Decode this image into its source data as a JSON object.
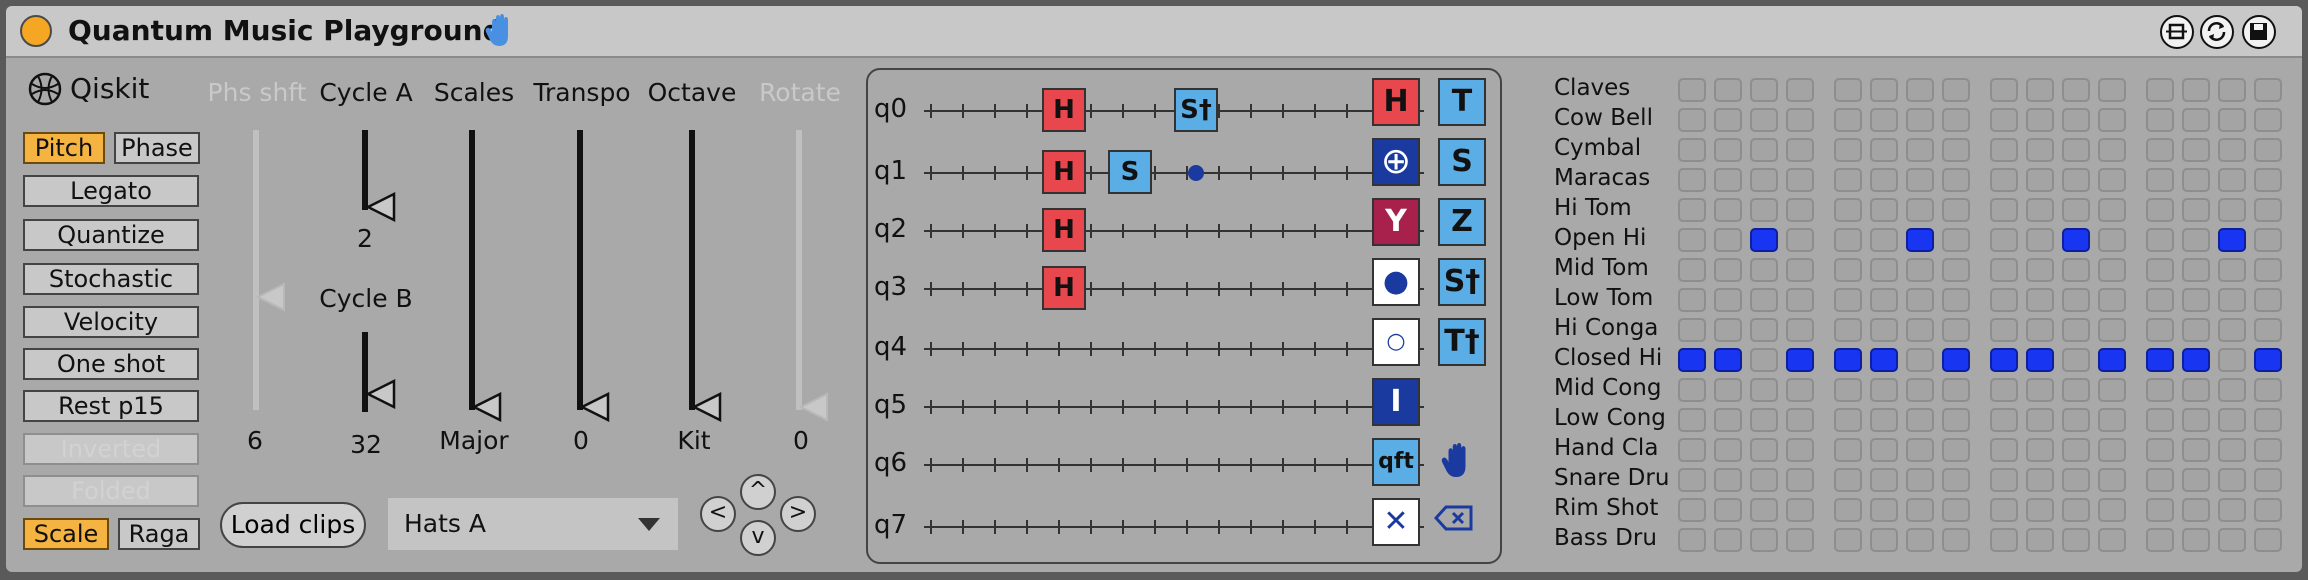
{
  "window": {
    "title": "Quantum Music Playground"
  },
  "colors": {
    "accent_orange": "#f5b342",
    "gate_red": "#e8474e",
    "gate_blue": "#5aaee5",
    "navy": "#1a3aa0",
    "step_on": "#1836f2"
  },
  "left_panel": {
    "logo_text": "Qiskit",
    "buttons": {
      "pitch": "Pitch",
      "phase": "Phase",
      "legato": "Legato",
      "quantize": "Quantize",
      "stochastic": "Stochastic",
      "velocity": "Velocity",
      "one_shot": "One shot",
      "rest": "Rest p15",
      "inverted": "Inverted",
      "folded": "Folded",
      "scale": "Scale",
      "raga": "Raga"
    },
    "toggles": {
      "pitch": true,
      "phase": false,
      "scale": true,
      "raga": false,
      "inverted": false,
      "folded": false
    }
  },
  "controls": {
    "phs_shft": {
      "label": "Phs shft",
      "value": "6"
    },
    "cycle_a": {
      "label": "Cycle A",
      "value": "2"
    },
    "cycle_b": {
      "label": "Cycle B",
      "value": "32"
    },
    "scales": {
      "label": "Scales",
      "value": "Major"
    },
    "transpo": {
      "label": "Transpo",
      "value": "0"
    },
    "octave": {
      "label": "Octave",
      "value": "Kit"
    },
    "rotate": {
      "label": "Rotate",
      "value": "0"
    }
  },
  "clips": {
    "load_label": "Load clips",
    "selected": "Hats A"
  },
  "nav": {
    "up": "^",
    "down": "v",
    "left": "<",
    "right": ">"
  },
  "circuit": {
    "qubits": [
      "q0",
      "q1",
      "q2",
      "q3",
      "q4",
      "q5",
      "q6",
      "q7"
    ],
    "gates": [
      {
        "label": "H",
        "qubit": 0,
        "step": 1,
        "color": "red"
      },
      {
        "label": "S†",
        "qubit": 0,
        "step": 3,
        "color": "blue"
      },
      {
        "label": "H",
        "qubit": 1,
        "step": 1,
        "color": "red"
      },
      {
        "label": "S",
        "qubit": 1,
        "step": 2,
        "color": "blue"
      },
      {
        "label": "H",
        "qubit": 2,
        "step": 1,
        "color": "red"
      },
      {
        "label": "H",
        "qubit": 3,
        "step": 1,
        "color": "red"
      }
    ],
    "control_dots": [
      {
        "qubit": 1,
        "step": 3
      }
    ]
  },
  "palette": {
    "left": [
      "H",
      "⊕",
      "Y",
      "●",
      "○",
      "I",
      "qft",
      "✕"
    ],
    "right": [
      "T",
      "S",
      "Z",
      "S†",
      "T†"
    ]
  },
  "drums": {
    "instruments": [
      "Claves",
      "Cow Bell",
      "Cymbal",
      "Maracas",
      "Hi Tom",
      "Open Hi",
      "Mid Tom",
      "Low Tom",
      "Hi Conga",
      "Closed Hi",
      "Mid Cong",
      "Low Cong",
      "Hand Cla",
      "Snare Dru",
      "Rim Shot",
      "Bass Dru"
    ],
    "steps": 16,
    "active": {
      "Open Hi": [
        2,
        6,
        10,
        14
      ],
      "Closed Hi": [
        0,
        1,
        3,
        4,
        5,
        7,
        8,
        9,
        11,
        12,
        13,
        15
      ]
    }
  }
}
